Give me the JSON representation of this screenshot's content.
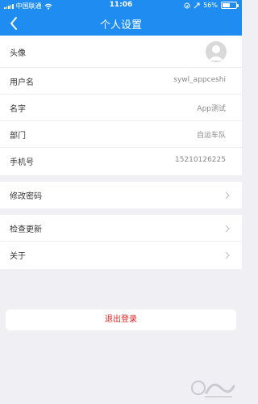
{
  "status_bar": {
    "carrier": "中国联通",
    "time": "11:06",
    "battery_text": "56%",
    "battery_level": 0.56
  },
  "nav": {
    "title": "个人设置",
    "back_icon": "chevron-left-icon"
  },
  "profile": {
    "avatar_label": "头像",
    "username_label": "用户名",
    "username_value": "sywl_appceshi",
    "name_label": "名字",
    "name_value": "App测试",
    "department_label": "部门",
    "department_value": "自运车队",
    "phone_label": "手机号",
    "phone_value": "15210126225"
  },
  "actions": {
    "change_password": "修改密码",
    "check_update": "检查更新",
    "about": "关于"
  },
  "logout_label": "退出登录",
  "colors": {
    "header": "#1f8cf2",
    "logout_text": "#e02020",
    "page_bg": "#efeff4"
  }
}
